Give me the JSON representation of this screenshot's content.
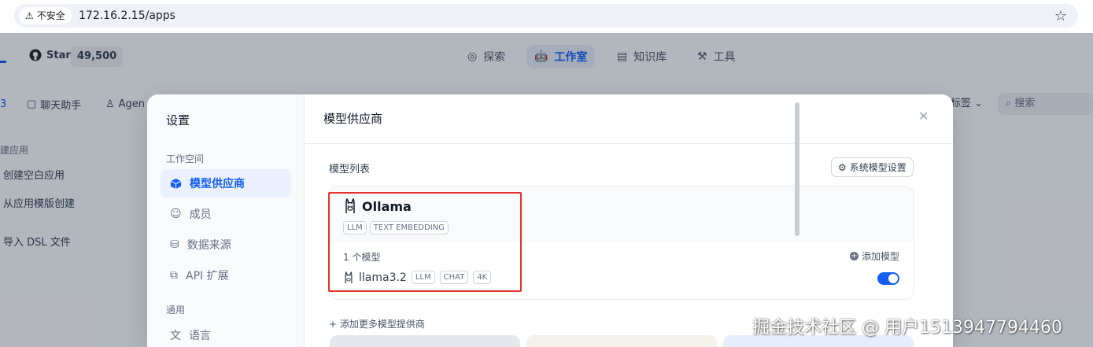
{
  "browser": {
    "insecure_label": "不安全",
    "url": "172.16.2.15/apps"
  },
  "topnav": {
    "github_label": "Star",
    "github_count": "49,500",
    "items": [
      {
        "label": "探索",
        "icon": "compass-icon",
        "active": false
      },
      {
        "label": "工作室",
        "icon": "robot-icon",
        "active": true
      },
      {
        "label": "知识库",
        "icon": "book-icon",
        "active": false
      },
      {
        "label": "工具",
        "icon": "hammer-icon",
        "active": false
      }
    ]
  },
  "filterbar": {
    "chip_partial": "3",
    "chat_assistant": "聊天助手",
    "agent": "Agen",
    "tag_select": "标签",
    "search_placeholder": "搜索"
  },
  "left_list": {
    "section": "建应用",
    "items": [
      "创建空白应用",
      "从应用模版创建",
      "导入 DSL 文件"
    ]
  },
  "modal": {
    "sidebar": {
      "title": "设置",
      "section_workspace": "工作空间",
      "items": [
        {
          "label": "模型供应商",
          "icon": "cube-icon",
          "active": true
        },
        {
          "label": "成员",
          "icon": "members-icon",
          "active": false
        },
        {
          "label": "数据来源",
          "icon": "database-icon",
          "active": false
        },
        {
          "label": "API 扩展",
          "icon": "puzzle-icon",
          "active": false
        }
      ],
      "section_general": "通用",
      "general_items": [
        {
          "label": "语言",
          "icon": "translate-icon"
        }
      ]
    },
    "content": {
      "title": "模型供应商",
      "list_label": "模型列表",
      "system_settings_button": "系统模型设置",
      "provider": {
        "name": "Ollama",
        "tags": [
          "LLM",
          "TEXT EMBEDDING"
        ],
        "model_count": "1 个模型",
        "add_model": "添加模型",
        "models": [
          {
            "name": "llama3.2",
            "tags": [
              "LLM",
              "CHAT",
              "4K"
            ],
            "enabled": true
          }
        ]
      },
      "add_more_providers": "添加更多模型提供商"
    }
  },
  "watermark": "掘金技术社区 @ 用户1513947794460",
  "colors": {
    "accent": "#155eef",
    "highlight_box": "#e5302b"
  }
}
